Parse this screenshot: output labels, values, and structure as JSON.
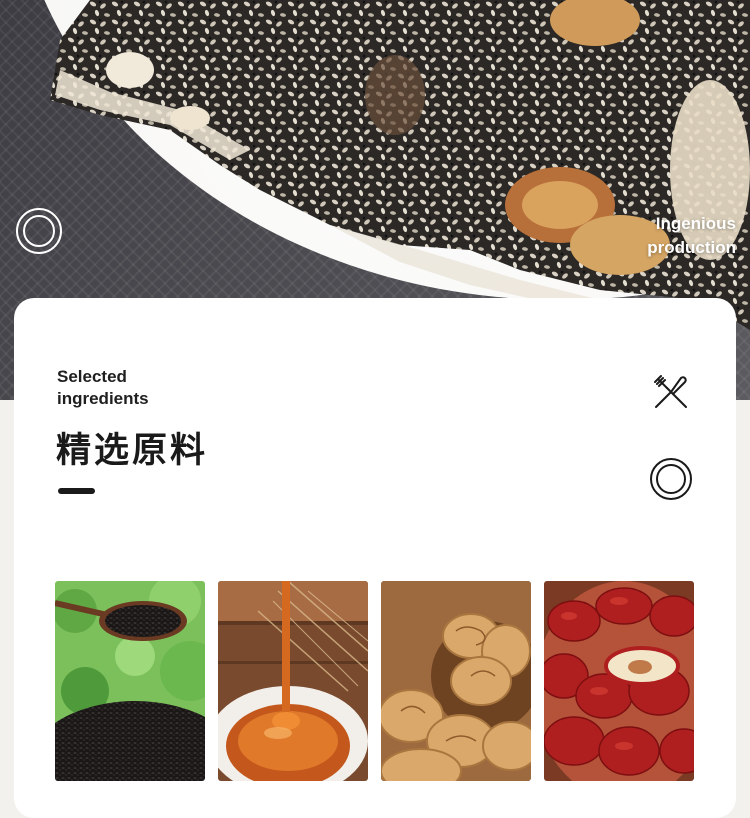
{
  "hero": {
    "caption_line1": "Ingenious",
    "caption_line2": "production"
  },
  "section": {
    "title_en_line1": "Selected",
    "title_en_line2": "ingredients",
    "title_zh": "精选原料"
  },
  "icons": {
    "top_left": "ring-icon",
    "utensils": "fork-knife-icon",
    "plate": "plate-icon"
  },
  "ingredients": [
    "black-sesame",
    "honey",
    "walnut",
    "red-jujube"
  ]
}
